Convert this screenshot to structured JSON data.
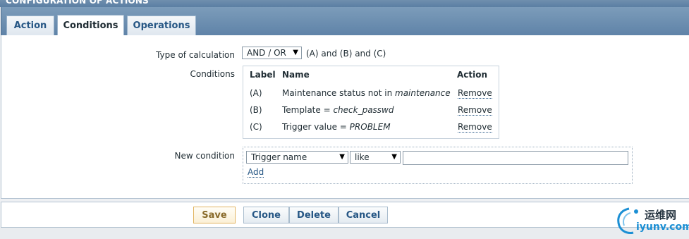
{
  "header": {
    "title": "CONFIGURATION OF ACTIONS"
  },
  "tabs": [
    {
      "label": "Action",
      "active": false
    },
    {
      "label": "Conditions",
      "active": true
    },
    {
      "label": "Operations",
      "active": false
    }
  ],
  "form": {
    "calc_label": "Type of calculation",
    "calc_value": "AND / OR",
    "calc_expression": "(A) and (B) and (C)",
    "conditions_label": "Conditions",
    "conditions_table": {
      "headers": {
        "label": "Label",
        "name": "Name",
        "action": "Action"
      },
      "rows": [
        {
          "label": "(A)",
          "name_prefix": "Maintenance status not in ",
          "name_value": "maintenance",
          "action": "Remove"
        },
        {
          "label": "(B)",
          "name_prefix": "Template = ",
          "name_value": "check_passwd",
          "action": "Remove"
        },
        {
          "label": "(C)",
          "name_prefix": "Trigger value = ",
          "name_value": "PROBLEM",
          "action": "Remove"
        }
      ]
    },
    "new_condition_label": "New condition",
    "new_condition": {
      "type_value": "Trigger name",
      "operator_value": "like",
      "text_value": "",
      "add_label": "Add"
    }
  },
  "buttons": {
    "save": "Save",
    "clone": "Clone",
    "delete": "Delete",
    "cancel": "Cancel"
  },
  "watermark": {
    "cn": "运维网",
    "en": "iyunv.com"
  },
  "colors": {
    "header_blue": "#5f83a8",
    "link_blue": "#275785",
    "save_border": "#e2b562",
    "watermark_blue": "#1b8fd4"
  }
}
